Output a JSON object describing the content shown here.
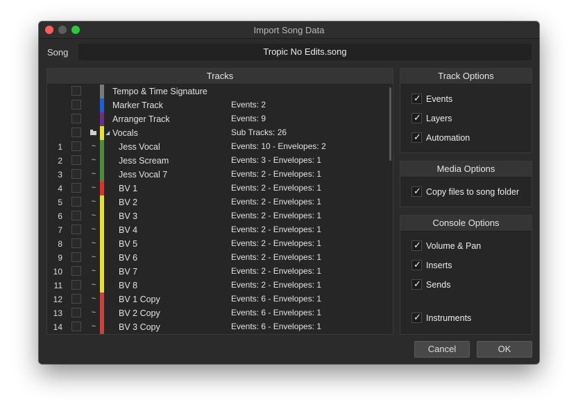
{
  "window": {
    "title": "Import Song Data"
  },
  "song": {
    "label": "Song",
    "name": "Tropic No Edits.song"
  },
  "tracks_panel": {
    "title": "Tracks",
    "rows": [
      {
        "num": "",
        "name": "Tempo & Time Signature",
        "info": "",
        "color": "#7a7a7a",
        "icon": ""
      },
      {
        "num": "",
        "name": "Marker Track",
        "info": "Events: 2",
        "color": "#1f5fd6",
        "icon": ""
      },
      {
        "num": "",
        "name": "Arranger Track",
        "info": "Events: 9",
        "color": "#6d2f86",
        "icon": ""
      },
      {
        "num": "",
        "name": "Vocals",
        "info": "Sub Tracks: 26",
        "color": "#e5df3a",
        "icon": "folder-icon"
      },
      {
        "num": "1",
        "name": "Jess Vocal",
        "info": "Events: 10 - Envelopes: 2",
        "color": "#4f8b3a",
        "icon": "audio-wave-icon"
      },
      {
        "num": "2",
        "name": "Jess Scream",
        "info": "Events: 3 - Envelopes: 1",
        "color": "#4f8b3a",
        "icon": "audio-wave-icon"
      },
      {
        "num": "3",
        "name": "Jess Vocal 7",
        "info": "Events: 2 - Envelopes: 1",
        "color": "#4f8b3a",
        "icon": "audio-wave-icon"
      },
      {
        "num": "4",
        "name": "BV 1",
        "info": "Events: 2 - Envelopes: 1",
        "color": "#e2302b",
        "icon": "audio-wave-icon"
      },
      {
        "num": "5",
        "name": "BV 2",
        "info": "Events: 2 - Envelopes: 1",
        "color": "#e5df3a",
        "icon": "audio-wave-icon"
      },
      {
        "num": "6",
        "name": "BV 3",
        "info": "Events: 2 - Envelopes: 1",
        "color": "#e5df3a",
        "icon": "audio-wave-icon"
      },
      {
        "num": "7",
        "name": "BV 4",
        "info": "Events: 2 - Envelopes: 1",
        "color": "#e5df3a",
        "icon": "audio-wave-icon"
      },
      {
        "num": "8",
        "name": "BV 5",
        "info": "Events: 2 - Envelopes: 1",
        "color": "#e5df3a",
        "icon": "audio-wave-icon"
      },
      {
        "num": "9",
        "name": "BV 6",
        "info": "Events: 2 - Envelopes: 1",
        "color": "#e5df3a",
        "icon": "audio-wave-icon"
      },
      {
        "num": "10",
        "name": "BV 7",
        "info": "Events: 2 - Envelopes: 1",
        "color": "#e5df3a",
        "icon": "audio-wave-icon"
      },
      {
        "num": "11",
        "name": "BV 8",
        "info": "Events: 2 - Envelopes: 1",
        "color": "#e5df3a",
        "icon": "audio-wave-icon"
      },
      {
        "num": "12",
        "name": "BV 1 Copy",
        "info": "Events: 6 - Envelopes: 1",
        "color": "#c9423c",
        "icon": "audio-wave-icon"
      },
      {
        "num": "13",
        "name": "BV 2 Copy",
        "info": "Events: 6 - Envelopes: 1",
        "color": "#c9423c",
        "icon": "audio-wave-icon"
      },
      {
        "num": "14",
        "name": "BV 3 Copy",
        "info": "Events: 6 - Envelopes: 1",
        "color": "#c9423c",
        "icon": "audio-wave-icon"
      }
    ]
  },
  "track_options": {
    "title": "Track Options",
    "items": [
      {
        "label": "Events",
        "checked": true
      },
      {
        "label": "Layers",
        "checked": true
      },
      {
        "label": "Automation",
        "checked": true
      }
    ]
  },
  "media_options": {
    "title": "Media Options",
    "items": [
      {
        "label": "Copy files to song folder",
        "checked": true
      }
    ]
  },
  "console_options": {
    "title": "Console Options",
    "items": [
      {
        "label": "Volume & Pan",
        "checked": true
      },
      {
        "label": "Inserts",
        "checked": true
      },
      {
        "label": "Sends",
        "checked": true
      },
      {
        "label": "Instruments",
        "checked": true
      }
    ]
  },
  "buttons": {
    "cancel": "Cancel",
    "ok": "OK"
  }
}
